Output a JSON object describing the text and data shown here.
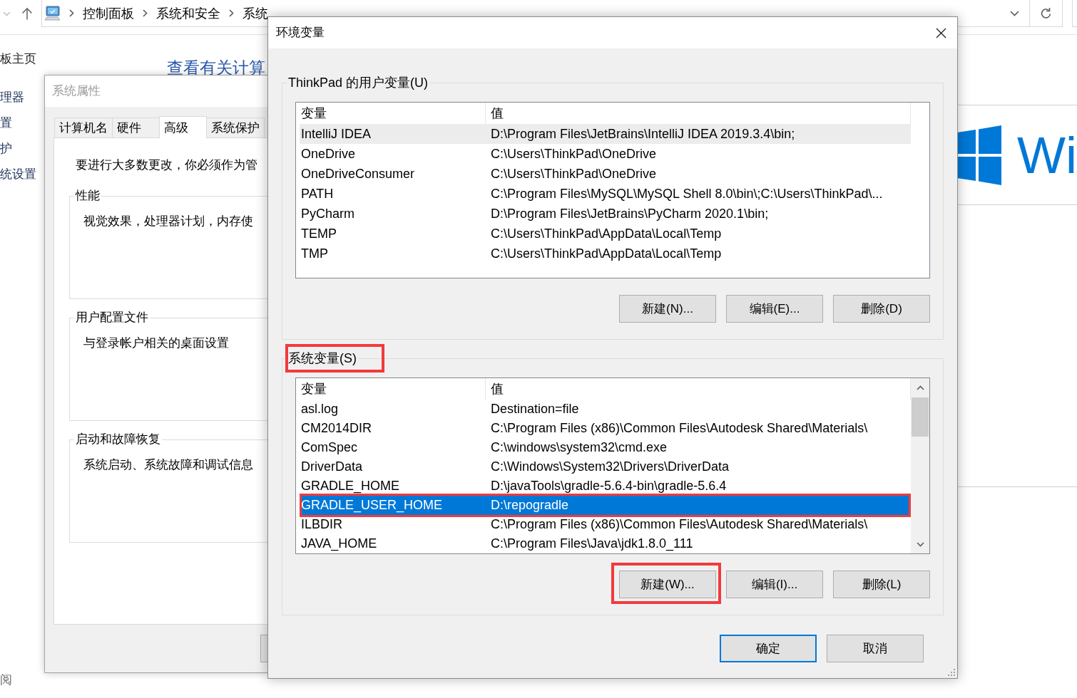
{
  "explorer": {
    "breadcrumbs": [
      "控制面板",
      "系统和安全",
      "系统"
    ],
    "nav": {
      "home": "板主页",
      "links": [
        "理器",
        "置",
        "护",
        "统设置"
      ],
      "footer": "阅"
    },
    "heading": "查看有关计算",
    "edition_text": "Wi"
  },
  "system_properties": {
    "title": "系统属性",
    "active": false,
    "tabs": [
      {
        "label": "计算机名",
        "selected": false
      },
      {
        "label": "硬件",
        "selected": false
      },
      {
        "label": "高级",
        "selected": true
      },
      {
        "label": "系统保护",
        "selected": false
      }
    ],
    "intro": "要进行大多数更改，你必须作为管",
    "groups": [
      {
        "title": "性能",
        "description": "视觉效果，处理器计划，内存使"
      },
      {
        "title": "用户配置文件",
        "description": "与登录帐户相关的桌面设置"
      },
      {
        "title": "启动和故障恢复",
        "description": "系统启动、系统故障和调试信息"
      }
    ]
  },
  "environment_variables": {
    "title": "环境变量",
    "active": true,
    "sections": [
      {
        "title": "ThinkPad 的用户变量(U)",
        "highlighted": false,
        "focused": false,
        "scrollbar": false,
        "columns": [
          "变量",
          "值"
        ],
        "rows": [
          {
            "variable": "IntelliJ IDEA",
            "value": "D:\\Program Files\\JetBrains\\IntelliJ IDEA 2019.3.4\\bin;",
            "selected": true,
            "highlighted": false
          },
          {
            "variable": "OneDrive",
            "value": "C:\\Users\\ThinkPad\\OneDrive",
            "selected": false,
            "highlighted": false
          },
          {
            "variable": "OneDriveConsumer",
            "value": "C:\\Users\\ThinkPad\\OneDrive",
            "selected": false,
            "highlighted": false
          },
          {
            "variable": "PATH",
            "value": "C:\\Program Files\\MySQL\\MySQL Shell 8.0\\bin\\;C:\\Users\\ThinkPad\\...",
            "selected": false,
            "highlighted": false
          },
          {
            "variable": "PyCharm",
            "value": "D:\\Program Files\\JetBrains\\PyCharm 2020.1\\bin;",
            "selected": false,
            "highlighted": false
          },
          {
            "variable": "TEMP",
            "value": "C:\\Users\\ThinkPad\\AppData\\Local\\Temp",
            "selected": false,
            "highlighted": false
          },
          {
            "variable": "TMP",
            "value": "C:\\Users\\ThinkPad\\AppData\\Local\\Temp",
            "selected": false,
            "highlighted": false
          }
        ],
        "buttons": [
          {
            "label": "新建(N)...",
            "highlighted": false
          },
          {
            "label": "编辑(E)...",
            "highlighted": false
          },
          {
            "label": "删除(D)",
            "highlighted": false
          }
        ]
      },
      {
        "title": "系统变量(S)",
        "highlighted": true,
        "focused": true,
        "scrollbar": true,
        "columns": [
          "变量",
          "值"
        ],
        "rows": [
          {
            "variable": "asl.log",
            "value": "Destination=file",
            "selected": false,
            "highlighted": false
          },
          {
            "variable": "CM2014DIR",
            "value": "C:\\Program Files (x86)\\Common Files\\Autodesk Shared\\Materials\\",
            "selected": false,
            "highlighted": false
          },
          {
            "variable": "ComSpec",
            "value": "C:\\windows\\system32\\cmd.exe",
            "selected": false,
            "highlighted": false
          },
          {
            "variable": "DriverData",
            "value": "C:\\Windows\\System32\\Drivers\\DriverData",
            "selected": false,
            "highlighted": false
          },
          {
            "variable": "GRADLE_HOME",
            "value": "D:\\javaTools\\gradle-5.6.4-bin\\gradle-5.6.4",
            "selected": false,
            "highlighted": false
          },
          {
            "variable": "GRADLE_USER_HOME",
            "value": "D:\\repogradle",
            "selected": true,
            "highlighted": true
          },
          {
            "variable": "ILBDIR",
            "value": "C:\\Program Files (x86)\\Common Files\\Autodesk Shared\\Materials\\",
            "selected": false,
            "highlighted": false
          },
          {
            "variable": "JAVA_HOME",
            "value": "C:\\Program Files\\Java\\jdk1.8.0_111",
            "selected": false,
            "highlighted": false
          }
        ],
        "buttons": [
          {
            "label": "新建(W)...",
            "highlighted": true
          },
          {
            "label": "编辑(I)...",
            "highlighted": false
          },
          {
            "label": "删除(L)",
            "highlighted": false
          }
        ]
      }
    ],
    "buttons": [
      {
        "label": "确定",
        "default": true
      },
      {
        "label": "取消",
        "default": false
      }
    ]
  }
}
